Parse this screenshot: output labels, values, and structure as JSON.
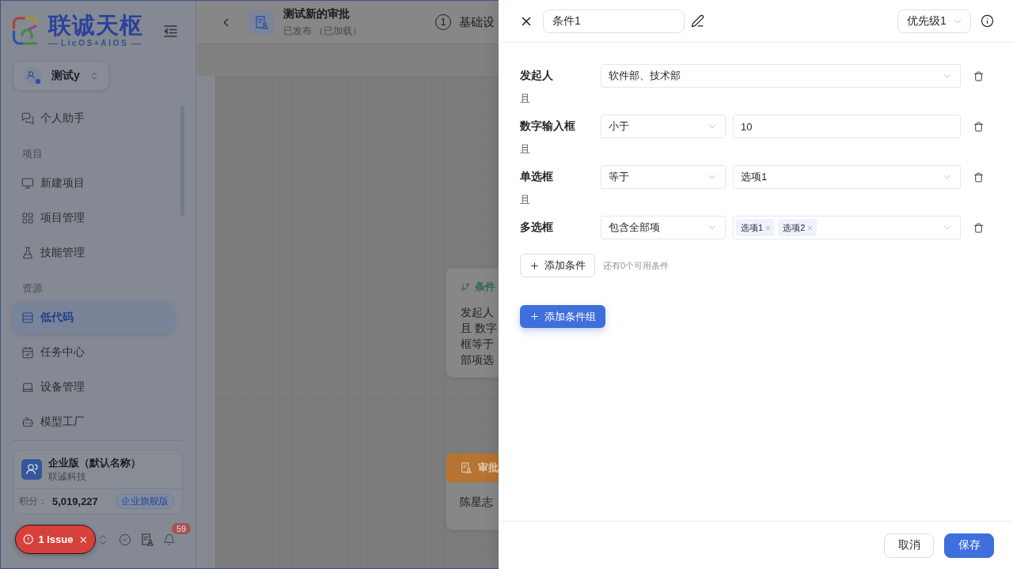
{
  "sidebar": {
    "logo": {
      "name": "联诚天枢",
      "tagline": "LicOS+AIOS"
    },
    "workspace": {
      "name": "测试y"
    },
    "sections": [
      {
        "items": [
          {
            "label": "个人助手",
            "selected": false
          }
        ]
      },
      {
        "title": "项目",
        "items": [
          {
            "label": "新建项目",
            "selected": false
          },
          {
            "label": "项目管理",
            "selected": false
          },
          {
            "label": "技能管理",
            "selected": false
          }
        ]
      },
      {
        "title": "资源",
        "items": [
          {
            "label": "低代码",
            "selected": true
          },
          {
            "label": "任务中心",
            "selected": false
          },
          {
            "label": "设备管理",
            "selected": false
          },
          {
            "label": "模型工厂",
            "selected": false
          }
        ]
      }
    ],
    "org_card": {
      "title": "企业版（默认名称）",
      "company": "联诚科技",
      "points_label": "积分：",
      "points": "5,019,227",
      "plan": "企业旗舰版"
    },
    "notifications": {
      "count": "59"
    }
  },
  "dev_indicator": {
    "label": "1 Issue"
  },
  "page_header": {
    "title": "测试新的审批",
    "subtitle": "已发布 （已加载）",
    "step": {
      "number": "1",
      "label": "基础设"
    }
  },
  "canvas": {
    "nodes": [
      {
        "kind": "condition",
        "title": "条件",
        "lines": [
          "发起人",
          "且 数字",
          "框等于",
          "部项选"
        ]
      },
      {
        "kind": "approver",
        "title": "审批",
        "body": "陈星志"
      }
    ]
  },
  "drawer": {
    "title": "条件1",
    "priority": "优先级1",
    "conditions": [
      {
        "field": "发起人",
        "kind": "select",
        "value": "软件部、技术部",
        "connector": "且"
      },
      {
        "field": "数字输入框",
        "kind": "input",
        "operator": "小于",
        "value": "10",
        "connector": "且"
      },
      {
        "field": "单选框",
        "kind": "select",
        "operator": "等于",
        "value": "选项1",
        "connector": "且"
      },
      {
        "field": "多选框",
        "kind": "tags",
        "operator": "包含全部项",
        "tags": [
          "选项1",
          "选项2"
        ]
      }
    ],
    "add_condition": "添加条件",
    "remaining_hint": "还有0个可用条件",
    "add_group": "添加条件组",
    "buttons": [
      {
        "label": "取消",
        "kind": "default"
      },
      {
        "label": "保存",
        "kind": "primary"
      }
    ]
  }
}
